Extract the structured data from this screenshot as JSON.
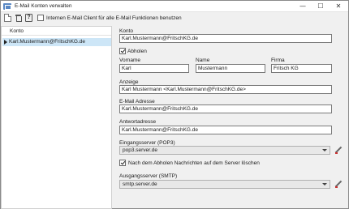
{
  "window": {
    "title": "E-Mail Konten verwalten",
    "controls": {
      "minimize": "—",
      "maximize": "☐",
      "close": "✕"
    }
  },
  "toolbar": {
    "help_glyph": "?",
    "internal_client_label": "Internen E-Mail Client für alle E-Mail Funktionen benutzen",
    "internal_client_checked": false
  },
  "accounts": {
    "column_header": "Konto",
    "items": [
      "Karl.Mustermann@FritschKG.de"
    ]
  },
  "form": {
    "konto_label": "Konto",
    "konto_value": "Karl.Mustermann@FritschKG.de",
    "abholen_label": "Abholen",
    "abholen_checked": true,
    "vorname_label": "Vorname",
    "vorname_value": "Karl",
    "name_label": "Name",
    "name_value": "Mustermann",
    "firma_label": "Firma",
    "firma_value": "Fritsch KG",
    "anzeige_label": "Anzeige",
    "anzeige_value": "Karl Mustermann <Karl.Mustermann@FritschKG.de>",
    "email_label": "E-Mail Adresse",
    "email_value": "Karl.Mustermann@FritschKG.de",
    "antwort_label": "Antwortadresse",
    "antwort_value": "Karl.Mustermann@FritschKG.de",
    "eingang_label": "Eingangsserver (POP3)",
    "eingang_value": "pop3.server.de",
    "loeschen_label": "Nach dem Abholen Nachrichten auf dem Server löschen",
    "loeschen_checked": true,
    "ausgang_label": "Ausgangsserver (SMTP)",
    "ausgang_value": "smtp.server.de"
  }
}
